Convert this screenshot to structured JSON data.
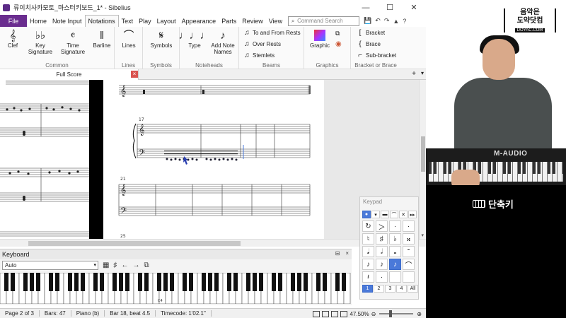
{
  "window": {
    "title": "류이치사카모토_마스터키보드_1* - Sibelius",
    "minimize": "—",
    "maximize": "☐",
    "close": "✕"
  },
  "menu": {
    "file": "File",
    "items": [
      "Home",
      "Note Input",
      "Notations",
      "Text",
      "Play",
      "Layout",
      "Appearance",
      "Parts",
      "Review",
      "View"
    ],
    "active_index": 2,
    "search_placeholder": "Command Search"
  },
  "ribbon": {
    "common": {
      "label": "Common",
      "clef": "Clef",
      "key_signature": "Key Signature",
      "time_signature": "Time Signature",
      "barline": "Barline"
    },
    "lines": {
      "label": "Lines",
      "lines_btn": "Lines"
    },
    "symbols": {
      "label": "Symbols",
      "symbols_btn": "Symbols"
    },
    "noteheads": {
      "label": "Noteheads",
      "type_btn": "Type",
      "add_note_names": "Add Note Names"
    },
    "beams": {
      "label": "Beams",
      "to_and_from_rests": "To and From Rests",
      "over_rests": "Over Rests",
      "stemlets": "Stemlets"
    },
    "graphics": {
      "label": "Graphics",
      "graphic_btn": "Graphic"
    },
    "bracket": {
      "label": "Bracket or Brace",
      "bracket": "Bracket",
      "brace": "Brace",
      "sub_bracket": "Sub-bracket"
    }
  },
  "score_tab": {
    "label": "Full Score"
  },
  "score": {
    "bar_numbers": [
      "17",
      "21",
      "25"
    ]
  },
  "keyboard_panel": {
    "title": "Keyboard",
    "mode": "Auto",
    "c4_label": "C4"
  },
  "keypad": {
    "title": "Keypad",
    "tabs": [
      "●",
      "▾",
      "▬",
      "⌒",
      "✕",
      "▸▸"
    ],
    "grid": [
      "↻",
      "＞",
      "·",
      "·",
      "♮",
      "♯",
      "♭",
      "𝄪",
      "𝅘𝅥",
      "𝅗𝅥",
      "𝅝",
      "𝄻",
      "♪",
      "♪",
      "♪",
      "⌒",
      "𝄽",
      "·",
      "",
      ""
    ],
    "selected_grid": 14,
    "layouts": [
      "1",
      "2",
      "3",
      "4",
      "All"
    ],
    "selected_layout": 0
  },
  "status": {
    "page": "Page 2 of 3",
    "bars": "Bars: 47",
    "instrument": "Piano (b)",
    "position": "Bar 18, beat 4.5",
    "timecode": "Timecode: 1'02.1\"",
    "zoom": "47.50%"
  },
  "video": {
    "logo_line1": "음악은",
    "logo_line2": "도약닷컴",
    "logo_url": "DOYAC.COM",
    "synth_brand": "M-AUDIO",
    "caption": "단축키"
  }
}
